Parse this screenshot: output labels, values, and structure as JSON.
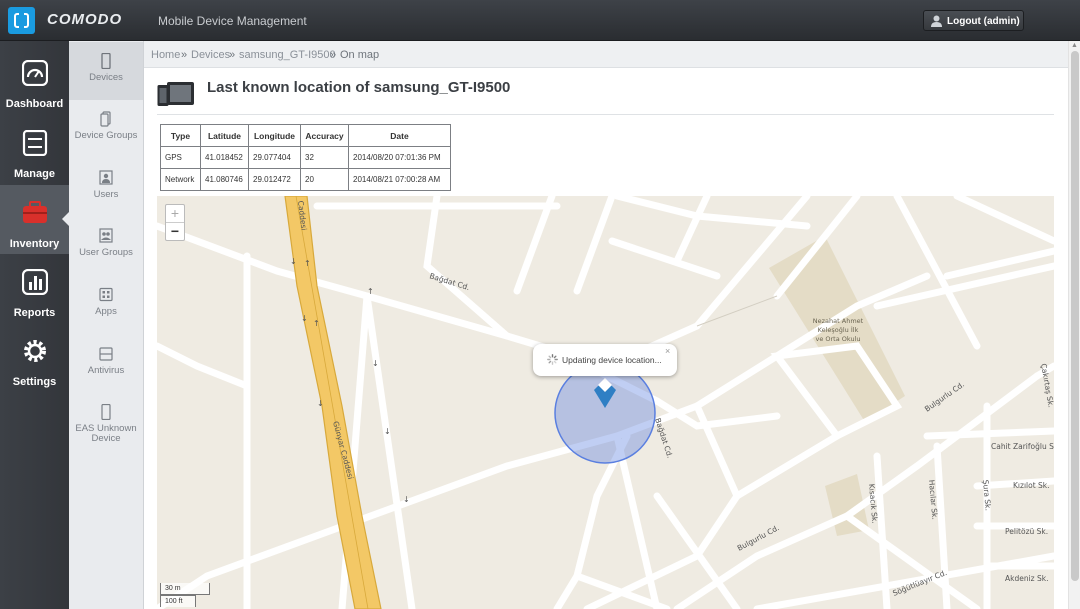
{
  "header": {
    "brand": "COMODO",
    "product": "Mobile Device Management",
    "logout_label": "Logout (admin)"
  },
  "main_nav": [
    {
      "label": "Dashboard",
      "icon": "dashboard-icon"
    },
    {
      "label": "Manage",
      "icon": "manage-icon"
    },
    {
      "label": "Inventory",
      "icon": "toolbox-icon"
    },
    {
      "label": "Reports",
      "icon": "reports-icon"
    },
    {
      "label": "Settings",
      "icon": "gear-icon"
    }
  ],
  "sub_nav": [
    {
      "label": "Devices",
      "icon": "phone-icon"
    },
    {
      "label": "Device Groups",
      "icon": "device-groups-icon"
    },
    {
      "label": "Users",
      "icon": "user-icon"
    },
    {
      "label": "User Groups",
      "icon": "user-groups-icon"
    },
    {
      "label": "Apps",
      "icon": "apps-icon"
    },
    {
      "label": "Antivirus",
      "icon": "antivirus-icon"
    },
    {
      "label": "EAS Unknown Device",
      "icon": "phone-icon"
    }
  ],
  "breadcrumb": {
    "home": "Home",
    "devices": "Devices",
    "device": "samsung_GT-I9500",
    "current": "On map",
    "sep": "»"
  },
  "page_title": "Last known location of samsung_GT-I9500",
  "location_table": {
    "headers": [
      "Type",
      "Latitude",
      "Longitude",
      "Accuracy",
      "Date"
    ],
    "rows": [
      [
        "GPS",
        "41.018452",
        "29.077404",
        "32",
        "2014/08/20 07:01:36 PM"
      ],
      [
        "Network",
        "41.080746",
        "29.012472",
        "20",
        "2014/08/21 07:00:28 AM"
      ]
    ]
  },
  "map": {
    "zoom_in": "+",
    "zoom_out": "−",
    "popup_text": "Updating device location...",
    "popup_close": "×",
    "scale_metric": "30 m",
    "scale_imperial": "100 ft",
    "labels": {
      "bagdat": "Bağdat Cd.",
      "caddesi": "Caddesi",
      "gunyar": "Günyar Caddesi",
      "school": [
        "Nezahat Ahmet",
        "Keleşoğlu İlk",
        "ve Orta Okulu"
      ],
      "bagdat_v": "Bağdat Cd.",
      "bulgurlu1": "Bulgurlu Cd.",
      "bulgurlu2": "Bulgurlu Cd.",
      "sogutluayir": "Söğütlüayır Cd.",
      "cahit": "Cahit Zarifoğlu Sk.",
      "kizilot": "Kızılot Sk.",
      "pelitozu": "Pelitözü Sk.",
      "akdeniz": "Akdeniz Sk.",
      "kisacik": "Kısacık Sk.",
      "hacilar": "Hacılar Sk.",
      "sura": "Şura Sk.",
      "cakirtas": "Çakırtaş Sk."
    }
  },
  "colors": {
    "accent": "#1a9be0",
    "inventory_red": "#d9302b",
    "accuracy_circle": "#5a7fe0",
    "marker": "#2f7fc4",
    "main_road": "#f3c866"
  }
}
